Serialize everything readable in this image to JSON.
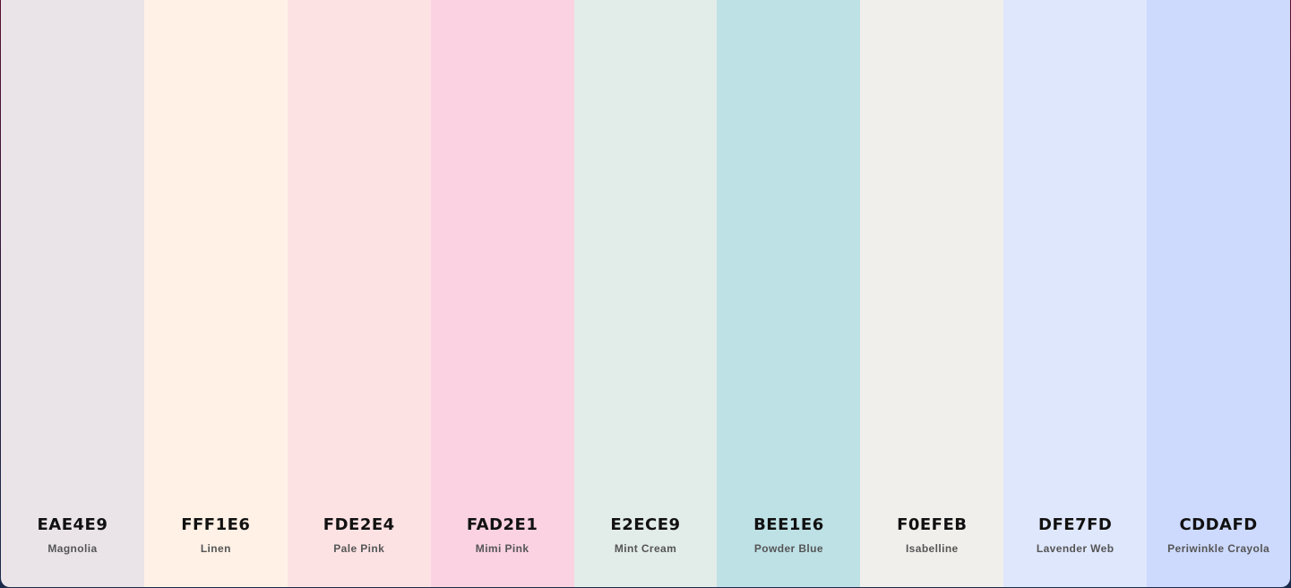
{
  "palette": {
    "colors": [
      {
        "hex": "EAE4E9",
        "name": "Magnolia",
        "color": "#EAE4E9"
      },
      {
        "hex": "FFF1E6",
        "name": "Linen",
        "color": "#FFF1E6"
      },
      {
        "hex": "FDE2E4",
        "name": "Pale Pink",
        "color": "#FDE2E4"
      },
      {
        "hex": "FAD2E1",
        "name": "Mimi Pink",
        "color": "#FAD2E1"
      },
      {
        "hex": "E2ECE9",
        "name": "Mint Cream",
        "color": "#E2ECE9"
      },
      {
        "hex": "BEE1E6",
        "name": "Powder Blue",
        "color": "#BEE1E6"
      },
      {
        "hex": "F0EFEB",
        "name": "Isabelline",
        "color": "#F0EFEB"
      },
      {
        "hex": "DFE7FD",
        "name": "Lavender Web",
        "color": "#DFE7FD"
      },
      {
        "hex": "CDDAFD",
        "name": "Periwinkle Crayola",
        "color": "#CDDAFD"
      }
    ]
  }
}
